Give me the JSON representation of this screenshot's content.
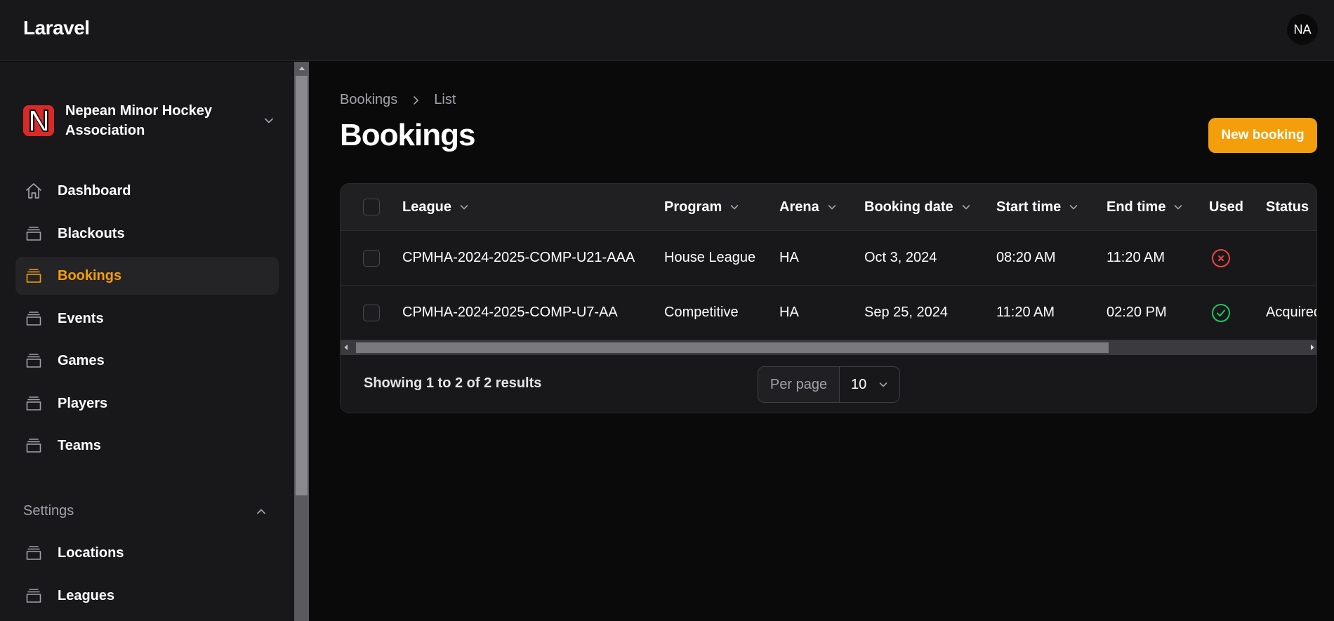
{
  "app": {
    "brand": "Laravel",
    "user_initials": "NA"
  },
  "sidebar": {
    "tenant": {
      "name": "Nepean Minor Hockey Association"
    },
    "items": [
      {
        "label": "Dashboard",
        "icon": "home-icon"
      },
      {
        "label": "Blackouts",
        "icon": "stack-icon"
      },
      {
        "label": "Bookings",
        "icon": "stack-icon",
        "active": true
      },
      {
        "label": "Events",
        "icon": "stack-icon"
      },
      {
        "label": "Games",
        "icon": "stack-icon"
      },
      {
        "label": "Players",
        "icon": "stack-icon"
      },
      {
        "label": "Teams",
        "icon": "stack-icon"
      }
    ],
    "settings_group": {
      "label": "Settings",
      "items": [
        {
          "label": "Locations",
          "icon": "stack-icon"
        },
        {
          "label": "Leagues",
          "icon": "stack-icon"
        }
      ]
    }
  },
  "breadcrumb": [
    "Bookings",
    "List"
  ],
  "page": {
    "title": "Bookings",
    "new_button": "New booking"
  },
  "table": {
    "columns": [
      "League",
      "Program",
      "Arena",
      "Booking date",
      "Start time",
      "End time",
      "Used",
      "Status"
    ],
    "rows": [
      {
        "league": "CPMHA-2024-2025-COMP-U21-AAA",
        "program": "House League",
        "arena": "HA",
        "date": "Oct 3, 2024",
        "start": "08:20 AM",
        "end": "11:20 AM",
        "used": false,
        "status": ""
      },
      {
        "league": "CPMHA-2024-2025-COMP-U7-AA",
        "program": "Competitive",
        "arena": "HA",
        "date": "Sep 25, 2024",
        "start": "11:20 AM",
        "end": "02:20 PM",
        "used": true,
        "status": "Acquired"
      }
    ]
  },
  "footer": {
    "showing": "Showing 1 to 2 of 2 results",
    "per_page_label": "Per page",
    "per_page_value": "10"
  },
  "colors": {
    "accent": "#f59e0b",
    "used_true": "#22c55e",
    "used_false": "#ef4444"
  }
}
